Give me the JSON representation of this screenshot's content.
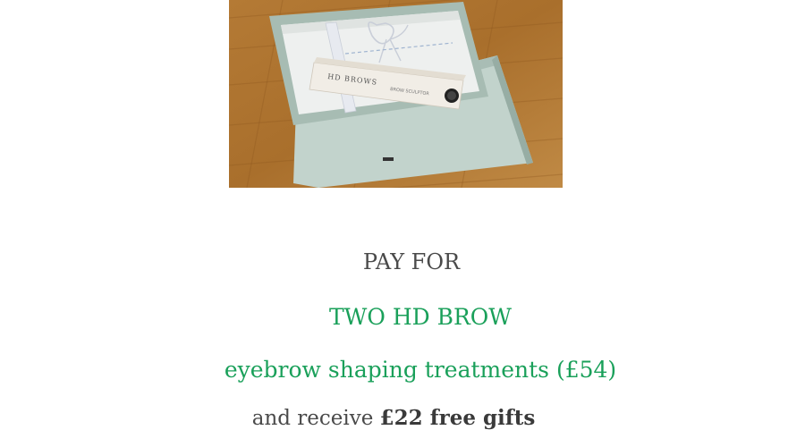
{
  "promo": {
    "line1": "PAY FOR",
    "line2": "TWO HD BROW",
    "line3": "eyebrow shaping treatments (£54)",
    "line4_prefix": "and receive ",
    "line4_bold": "£22 free gifts"
  },
  "image": {
    "product_brand": "HD BROWS",
    "product_name": "BROW SCULPTOR"
  },
  "colors": {
    "accent_green": "#1aa05a",
    "text_gray": "#4a4a4a",
    "wood": "#b0782f",
    "box_tray": "#b9cbc4"
  }
}
